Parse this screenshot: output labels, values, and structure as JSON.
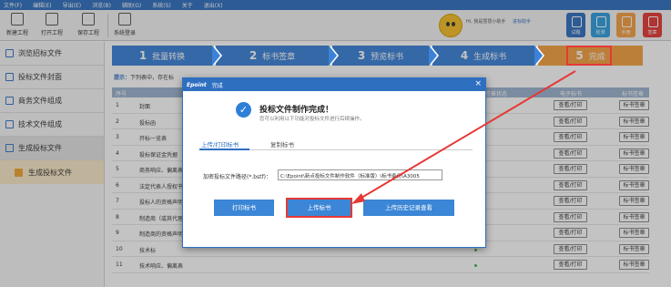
{
  "menu": [
    "文件(F)",
    "编辑(E)",
    "导出(E)",
    "浏览(B)",
    "辅助(G)",
    "系统(S)",
    "关于",
    "退出(X)"
  ],
  "toolbar": {
    "new": "新建工程",
    "open": "打开工程",
    "save": "保存工程",
    "login": "系统登录",
    "greeting": "Hi, 我是慧慧小助手",
    "link": "进标助手",
    "right_buttons": [
      {
        "label": "试题",
        "color": "#2f6fc0"
      },
      {
        "label": "检测",
        "color": "#2f9ee0"
      },
      {
        "label": "手册",
        "color": "#f5a142"
      },
      {
        "label": "签章",
        "color": "#e53935"
      }
    ]
  },
  "sidebar": {
    "items": [
      {
        "label": "浏览招标文件",
        "active": false
      },
      {
        "label": "投标文件封面",
        "active": false
      },
      {
        "label": "商务文件组成",
        "active": false
      },
      {
        "label": "技术文件组成",
        "active": false
      },
      {
        "label": "生成投标文件",
        "active": true
      }
    ],
    "sub": "生成投标文件"
  },
  "steps": [
    {
      "num": "1",
      "label": "批量转换"
    },
    {
      "num": "2",
      "label": "标书签章"
    },
    {
      "num": "3",
      "label": "预览标书"
    },
    {
      "num": "4",
      "label": "生成标书"
    },
    {
      "num": "5",
      "label": "完成"
    }
  ],
  "hint": {
    "label": "提示：",
    "text": "下列表中，存在标"
  },
  "table": {
    "headers": {
      "idx": "序号",
      "sign": "签章状态",
      "view": "电子标书",
      "op": "标书签章"
    },
    "rows": [
      {
        "idx": "1",
        "name": "封面"
      },
      {
        "idx": "2",
        "name": "投标函"
      },
      {
        "idx": "3",
        "name": "开标一览表"
      },
      {
        "idx": "4",
        "name": "投标保证金凭据"
      },
      {
        "idx": "5",
        "name": "商务响应、偏离表"
      },
      {
        "idx": "6",
        "name": "法定代表人授权书"
      },
      {
        "idx": "7",
        "name": "投标人的资格声明"
      },
      {
        "idx": "8",
        "name": "制造商（或其代理）"
      },
      {
        "idx": "9",
        "name": "制造商的资格声明"
      },
      {
        "idx": "10",
        "name": "技术标"
      },
      {
        "idx": "11",
        "name": "技术响应、偏离表"
      }
    ],
    "view_label": "查看/打印",
    "sign_label": "标书签章"
  },
  "dialog": {
    "logo": "Epoint",
    "title": "完成",
    "heading": "投标文件制作完成！",
    "sub": "您可以利用以下功能对投标文件进行后续操作。",
    "tabs": [
      "上传/打印标书",
      "复制标书"
    ],
    "path_label": "加密投标文件路径(*.bstf)：",
    "path_value": "C:\\Epoint\\新点投标文件制作软件（标准版）\\标书备份\\A3005",
    "buttons": {
      "print": "打印标书",
      "upload": "上传标书",
      "history": "上传历史记录查看"
    }
  }
}
